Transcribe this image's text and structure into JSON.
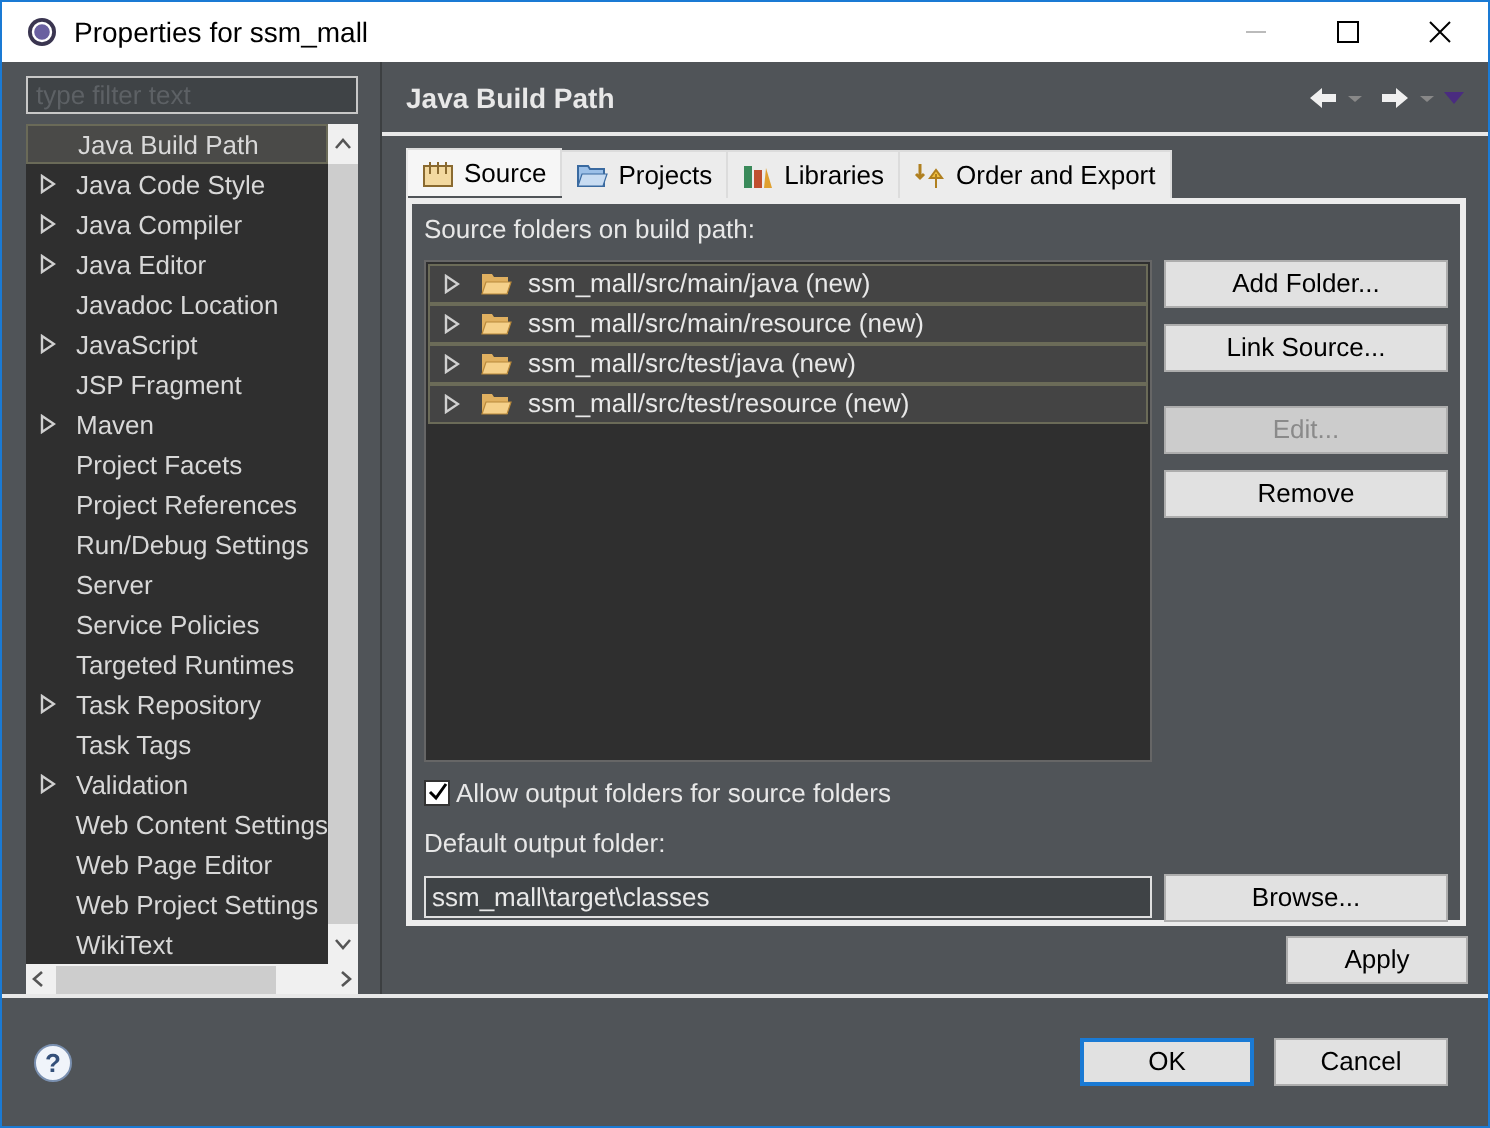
{
  "window": {
    "title": "Properties for ssm_mall"
  },
  "filter": {
    "placeholder": "type filter text"
  },
  "tree": [
    {
      "label": "Java Build Path",
      "expandable": false,
      "selected": true
    },
    {
      "label": "Java Code Style",
      "expandable": true,
      "selected": false
    },
    {
      "label": "Java Compiler",
      "expandable": true,
      "selected": false
    },
    {
      "label": "Java Editor",
      "expandable": true,
      "selected": false
    },
    {
      "label": "Javadoc Location",
      "expandable": false,
      "selected": false
    },
    {
      "label": "JavaScript",
      "expandable": true,
      "selected": false
    },
    {
      "label": "JSP Fragment",
      "expandable": false,
      "selected": false
    },
    {
      "label": "Maven",
      "expandable": true,
      "selected": false
    },
    {
      "label": "Project Facets",
      "expandable": false,
      "selected": false
    },
    {
      "label": "Project References",
      "expandable": false,
      "selected": false
    },
    {
      "label": "Run/Debug Settings",
      "expandable": false,
      "selected": false
    },
    {
      "label": "Server",
      "expandable": false,
      "selected": false
    },
    {
      "label": "Service Policies",
      "expandable": false,
      "selected": false
    },
    {
      "label": "Targeted Runtimes",
      "expandable": false,
      "selected": false
    },
    {
      "label": "Task Repository",
      "expandable": true,
      "selected": false
    },
    {
      "label": "Task Tags",
      "expandable": false,
      "selected": false
    },
    {
      "label": "Validation",
      "expandable": true,
      "selected": false
    },
    {
      "label": "Web Content Settings",
      "expandable": false,
      "selected": false
    },
    {
      "label": "Web Page Editor",
      "expandable": false,
      "selected": false
    },
    {
      "label": "Web Project Settings",
      "expandable": false,
      "selected": false
    },
    {
      "label": "WikiText",
      "expandable": false,
      "selected": false
    }
  ],
  "page": {
    "title": "Java Build Path"
  },
  "tabs": [
    {
      "label": "Source",
      "kind": "source",
      "selected": true
    },
    {
      "label": "Projects",
      "kind": "projects",
      "selected": false
    },
    {
      "label": "Libraries",
      "kind": "libraries",
      "selected": false
    },
    {
      "label": "Order and Export",
      "kind": "order",
      "selected": false
    }
  ],
  "source": {
    "heading": "Source folders on build path:",
    "folders": [
      {
        "label": "ssm_mall/src/main/java (new)"
      },
      {
        "label": "ssm_mall/src/main/resource (new)"
      },
      {
        "label": "ssm_mall/src/test/java (new)"
      },
      {
        "label": "ssm_mall/src/test/resource (new)"
      }
    ],
    "buttons": [
      {
        "label": "Add Folder...",
        "disabled": false
      },
      {
        "label": "Link Source...",
        "disabled": false
      },
      {
        "label": "Edit...",
        "disabled": true
      },
      {
        "label": "Remove",
        "disabled": false
      }
    ],
    "allow_output": {
      "label": "Allow output folders for source folders",
      "checked": true
    },
    "output_label": "Default output folder:",
    "output_value": "ssm_mall\\target\\classes",
    "browse": "Browse..."
  },
  "apply": "Apply",
  "help": "?",
  "footer": {
    "ok": "OK",
    "cancel": "Cancel"
  }
}
